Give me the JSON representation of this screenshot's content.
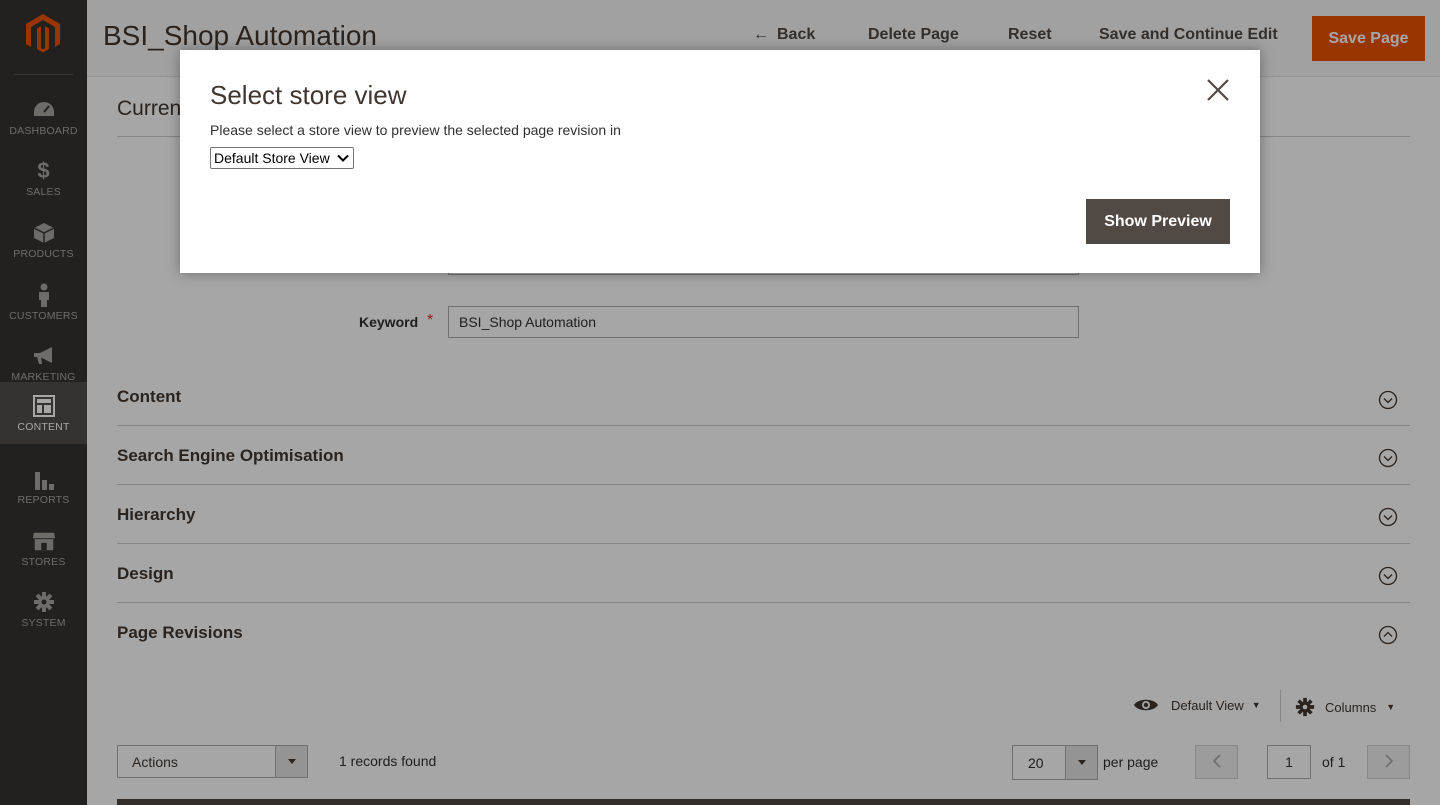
{
  "sidebar": {
    "items": [
      {
        "label": "DASHBOARD",
        "icon": "dashboard-icon"
      },
      {
        "label": "SALES",
        "icon": "dollar-icon"
      },
      {
        "label": "PRODUCTS",
        "icon": "box-icon"
      },
      {
        "label": "CUSTOMERS",
        "icon": "person-icon"
      },
      {
        "label": "MARKETING",
        "icon": "megaphone-icon"
      },
      {
        "label": "CONTENT",
        "icon": "layout-icon",
        "active": true
      },
      {
        "label": "REPORTS",
        "icon": "bar-chart-icon"
      },
      {
        "label": "STORES",
        "icon": "storefront-icon"
      },
      {
        "label": "SYSTEM",
        "icon": "gear-icon"
      }
    ]
  },
  "header": {
    "title": "BSI_Shop Automation",
    "back_label": "Back",
    "delete_label": "Delete Page",
    "reset_label": "Reset",
    "save_continue_label": "Save and Continue Edit",
    "save_label": "Save Page"
  },
  "current_tab_label": "Curren",
  "form": {
    "keyword_label": "Keyword",
    "keyword_required": "*",
    "keyword_value": "BSI_Shop Automation"
  },
  "sections": [
    {
      "title": "Content",
      "expanded": false
    },
    {
      "title": "Search Engine Optimisation",
      "expanded": false
    },
    {
      "title": "Hierarchy",
      "expanded": false
    },
    {
      "title": "Design",
      "expanded": false
    },
    {
      "title": "Page Revisions",
      "expanded": true
    }
  ],
  "grid": {
    "view_label": "Default View",
    "columns_label": "Columns",
    "actions_label": "Actions",
    "records_found": "1 records found",
    "per_page_value": "20",
    "per_page_label": "per page",
    "current_page": "1",
    "total_pages_label": "of 1"
  },
  "modal": {
    "title": "Select store view",
    "description": "Please select a store view to preview the selected page revision in",
    "select_value": "Default Store View",
    "button_label": "Show Preview"
  },
  "colors": {
    "sidebar_bg": "#373330",
    "primary_orange": "#eb5202",
    "secondary_button": "#514943"
  }
}
